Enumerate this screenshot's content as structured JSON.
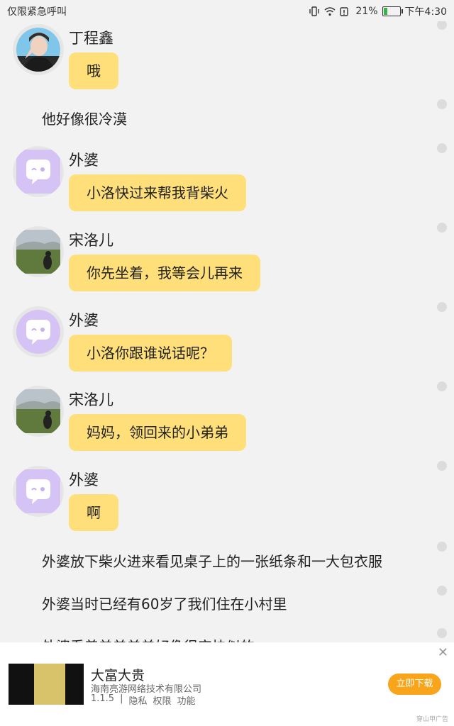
{
  "status_bar": {
    "left_text": "仅限紧急呼叫",
    "battery": "21%",
    "battery_fraction": 0.21,
    "time": "下午4:30",
    "icons": [
      "vibrate-icon",
      "wifi-icon",
      "battery-alert-icon",
      "battery-icon"
    ]
  },
  "messages": [
    {
      "speaker": "丁程鑫",
      "text": "哦",
      "avatar": "photo-portrait"
    },
    {
      "narration": "他好像很冷漠"
    },
    {
      "speaker": "外婆",
      "text": "小洛快过来帮我背柴火",
      "avatar": "chat-bubble-placeholder"
    },
    {
      "speaker": "宋洛儿",
      "text": "你先坐着，我等会儿再来",
      "avatar": "photo-landscape"
    },
    {
      "speaker": "外婆",
      "text": "小洛你跟谁说话呢？",
      "avatar": "chat-bubble-placeholder"
    },
    {
      "speaker": "宋洛儿",
      "text": "妈妈，领回来的小弟弟",
      "avatar": "photo-landscape"
    },
    {
      "speaker": "外婆",
      "text": "啊",
      "avatar": "chat-bubble-placeholder"
    },
    {
      "narration": "外婆放下柴火进来看见桌子上的一张纸条和一大包衣服"
    },
    {
      "narration": "外婆当时已经有60岁了我们住在小村里"
    },
    {
      "narration": "外婆看着弟弟弟弟好像很实快似的"
    }
  ],
  "ad": {
    "title": "大富大贵",
    "company": "海南亮游网络技术有限公司",
    "version": "1.1.5",
    "privacy": "隐私",
    "permissions": "权限",
    "features": "功能",
    "button": "立即下载",
    "source": "穿山甲广告",
    "close": "✕"
  },
  "colors": {
    "background": "#f2f2f2",
    "bubble": "#ffdf7a",
    "ad_button": "#f9a51b",
    "placeholder_avatar": "#d5c3f6"
  }
}
